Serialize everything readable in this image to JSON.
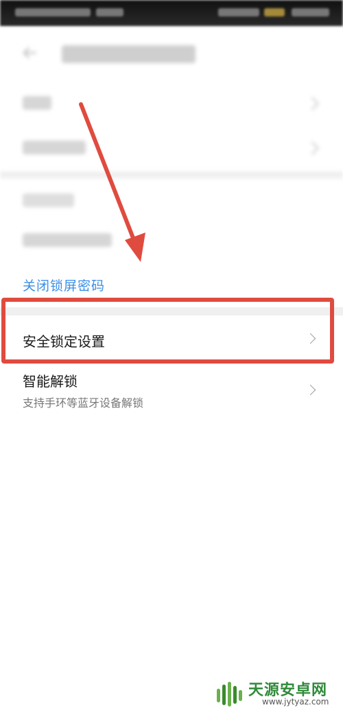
{
  "app": {
    "screen_title": ""
  },
  "settings": {
    "close_lock_password_link": "关闭锁屏密码",
    "security_lock_settings": {
      "label": "安全锁定设置"
    },
    "smart_unlock": {
      "label": "智能解锁",
      "subtitle": "支持手环等蓝牙设备解锁"
    }
  },
  "watermark": {
    "name": "天源安卓网",
    "url": "www.jytyaz.com"
  },
  "annotation": {
    "arrow_color": "#e04b3f",
    "box_color": "#e04b3f"
  }
}
